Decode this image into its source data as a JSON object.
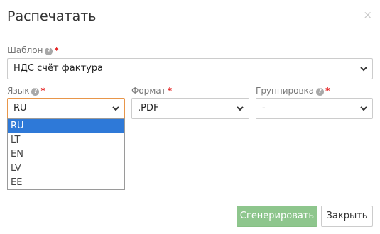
{
  "dialog": {
    "title": "Распечатать",
    "close_glyph": "×"
  },
  "template": {
    "label": "Шаблон",
    "required_mark": "*",
    "help_glyph": "?",
    "value": "НДС счёт фактура"
  },
  "language": {
    "label": "Язык",
    "required_mark": "*",
    "help_glyph": "?",
    "value": "RU",
    "options": [
      "RU",
      "LT",
      "EN",
      "LV",
      "EE"
    ],
    "selected_index": 0
  },
  "format": {
    "label": "Формат",
    "required_mark": "*",
    "value": ".PDF"
  },
  "grouping": {
    "label": "Группировка",
    "required_mark": "*",
    "help_glyph": "?",
    "value": "-"
  },
  "buttons": {
    "generate": "Сгенерировать",
    "close": "Закрыть"
  },
  "colors": {
    "primary_button": "#8ec68d",
    "selected_option": "#2e79d8",
    "required": "#e52222",
    "focus_border": "#e8964a"
  },
  "icons": {
    "close": "close-icon",
    "help": "help-icon",
    "dropdown": "chevron-down-icon"
  }
}
